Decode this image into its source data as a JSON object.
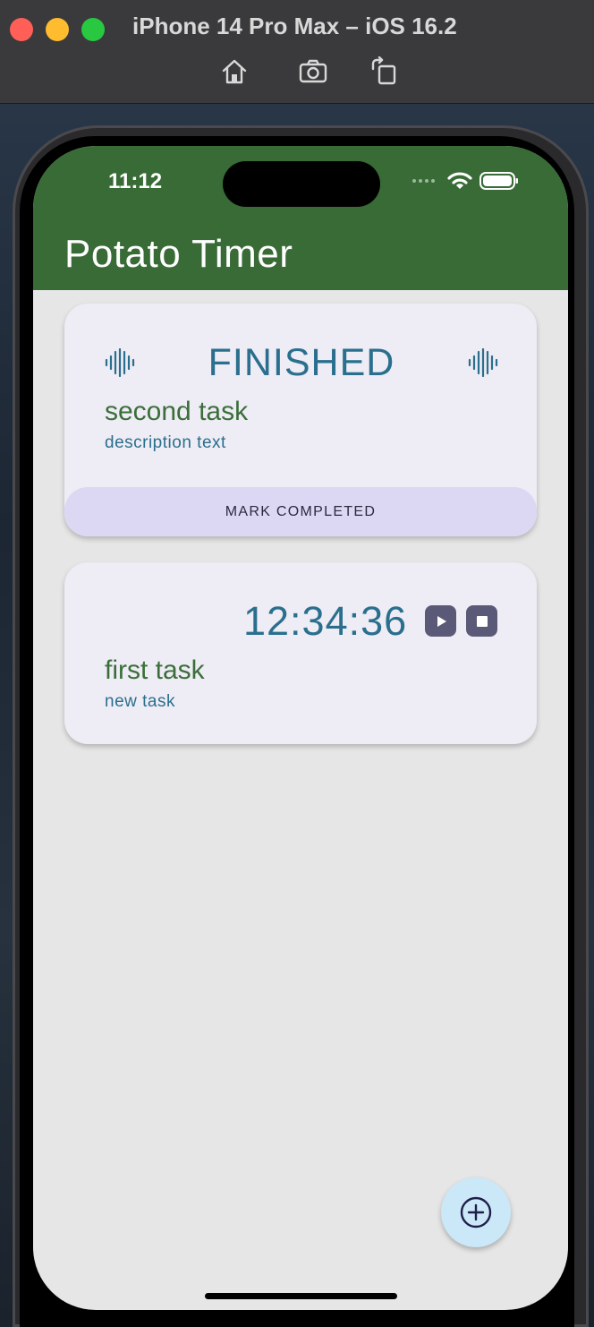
{
  "simulator": {
    "title": "iPhone 14 Pro Max – iOS 16.2",
    "tools": [
      "home-icon",
      "screenshot-icon",
      "rotate-icon"
    ]
  },
  "status_bar": {
    "time": "11:12"
  },
  "app": {
    "title": "Potato Timer",
    "accent_color": "#386b36"
  },
  "tasks": [
    {
      "state": "FINISHED",
      "title": "second task",
      "description": "description text",
      "action_label": "MARK COMPLETED"
    },
    {
      "timer": "12:34:36",
      "title": "first task",
      "description": "new task"
    }
  ]
}
